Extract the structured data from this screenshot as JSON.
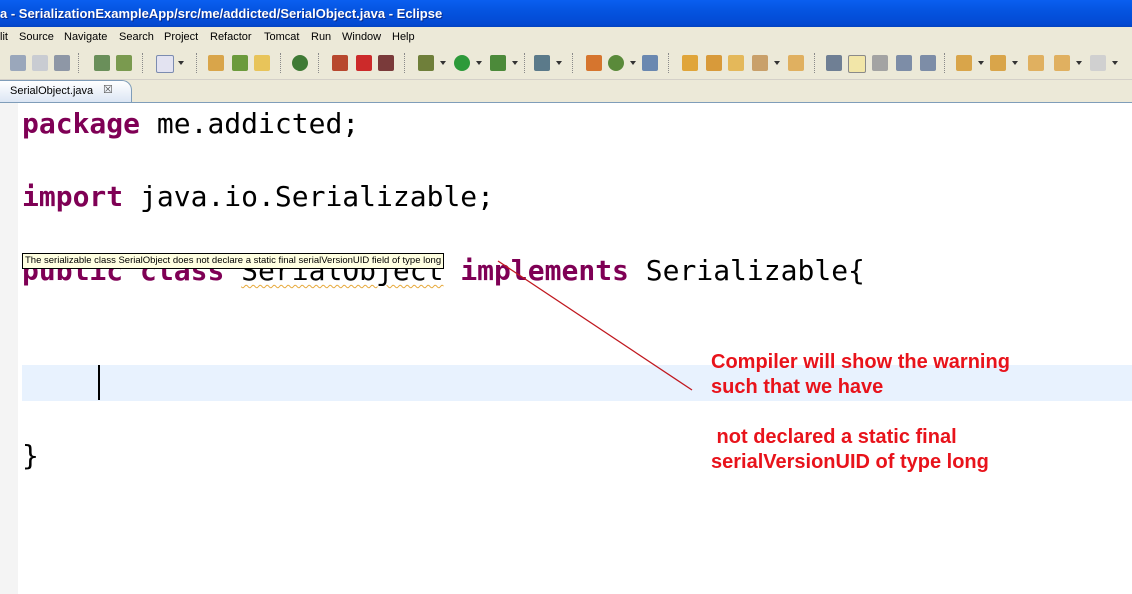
{
  "window": {
    "title": "a - SerializationExampleApp/src/me/addicted/SerialObject.java - Eclipse"
  },
  "menu": [
    "lit",
    "Source",
    "Navigate",
    "Search",
    "Project",
    "Refactor",
    "Tomcat",
    "Run",
    "Window",
    "Help"
  ],
  "tab": {
    "label": "SerialObject.java",
    "close": "☒"
  },
  "code": {
    "line1_kw": "package",
    "line1_rest": " me.addicted;",
    "line2_kw": "import",
    "line2_rest": " java.io.Serializable;",
    "line3_kw1": "public",
    "line3_kw2": "class",
    "line3_name": "SerialObject",
    "line3_kw3": "implements",
    "line3_rest": " Serializable{",
    "closing": "}"
  },
  "tooltip": {
    "text": "The serializable class SerialObject does not declare a static final serialVersionUID field of type long"
  },
  "annotation": {
    "line1": "Compiler will show the warning",
    "line2": "such that we have",
    "line3": " not declared a static final",
    "line4": "serialVersionUID of type long",
    "color": "#e8131b"
  },
  "colors": {
    "keyword": "#7f0055",
    "title_bar": "#0554e0",
    "current_line": "#e8f2fe",
    "tooltip_bg": "#ffffe1"
  },
  "icons": [
    "save-icon",
    "save-all-icon",
    "print-icon",
    "import-icon",
    "export-icon",
    "task-icon",
    "new-package-icon",
    "new-junit-icon",
    "new-class-icon",
    "open-perspective-icon",
    "debug-skip-icon",
    "remove-breakpoint-icon",
    "terminate-icon",
    "debug-icon",
    "run-icon",
    "external-tools-icon",
    "search-icon",
    "new-web-icon",
    "refresh-icon",
    "open-type-icon",
    "open-folder-icon",
    "open-folder2-icon",
    "open-folder3-icon",
    "pencil-icon",
    "open-folder4-icon",
    "toggle-mark-icon",
    "highlight-icon",
    "flashlight-icon",
    "show-whitespace-icon",
    "paragraph-icon",
    "next-annotation-icon",
    "previous-annotation-icon",
    "last-edit-icon",
    "back-icon",
    "forward-icon"
  ]
}
